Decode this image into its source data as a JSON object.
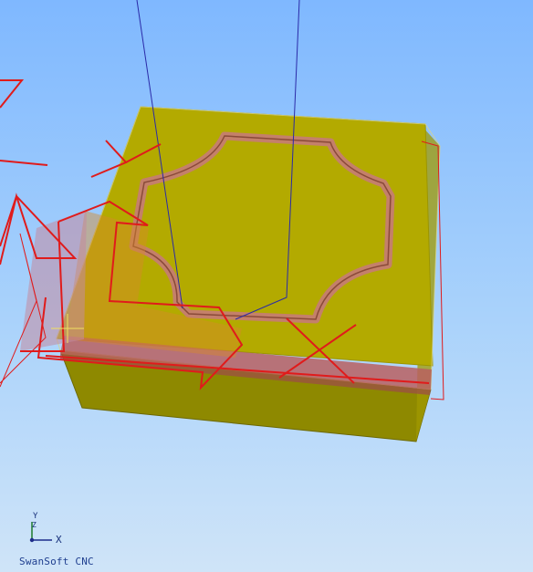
{
  "app": {
    "brand": "SwanSoft CNC"
  },
  "axes_indicator": {
    "x_label": "X",
    "y_label": "Y",
    "z_label": "Z"
  },
  "colors": {
    "sky_top": "#7fb8ff",
    "sky_bottom": "#cfe4f8",
    "stock_top": "#b0a800",
    "stock_side": "#8c8600",
    "groove": "#c07a63",
    "toolpath": "#e01b1b",
    "tool_line": "#2a2aa8"
  },
  "icons": [
    "axis-triad-icon",
    "origin-crosshair-icon"
  ]
}
